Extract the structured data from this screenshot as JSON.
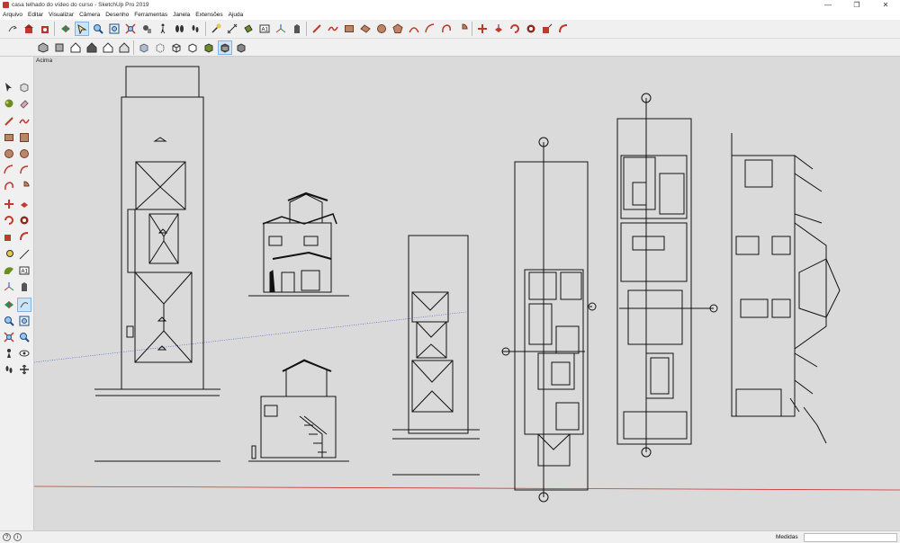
{
  "window": {
    "title": "casa telhado do vídeo do curso - SketchUp Pro 2019",
    "minimize": "—",
    "maximize": "❐",
    "close": "✕"
  },
  "menu": [
    "Arquivo",
    "Editar",
    "Visualizar",
    "Câmera",
    "Desenho",
    "Ferramentas",
    "Janela",
    "Extensões",
    "Ajuda"
  ],
  "scene": {
    "label": "Acima"
  },
  "status": {
    "measurements_label": "Medidas",
    "measurements_value": ""
  },
  "colors": {
    "accent_red": "#c0392b",
    "axis_red": "#cc3333",
    "axis_blue": "#3355cc",
    "viewport_bg": "#dadada"
  },
  "toolbar_top": [
    {
      "icon": "orbit-icon"
    },
    {
      "icon": "warehouse-icon"
    },
    {
      "icon": "extension-warehouse-icon"
    },
    {
      "icon": "section-plane-icon"
    },
    {
      "icon": "select-icon"
    },
    {
      "icon": "zoom-icon"
    },
    {
      "icon": "zoom-window-icon"
    },
    {
      "icon": "zoom-extents-icon"
    },
    {
      "icon": "position-camera-icon"
    },
    {
      "icon": "walk-icon"
    },
    {
      "icon": "look-around-icon"
    },
    {
      "icon": "tape-measure-icon"
    },
    {
      "icon": "paint-bucket-icon"
    },
    {
      "icon": "text-icon"
    },
    {
      "icon": "axes-icon"
    },
    {
      "icon": "3d-text-icon"
    },
    {
      "icon": "line-icon"
    },
    {
      "icon": "freehand-icon"
    },
    {
      "icon": "rectangle-icon"
    },
    {
      "icon": "rotated-rectangle-icon"
    },
    {
      "icon": "circle-icon"
    },
    {
      "icon": "polygon-icon"
    },
    {
      "icon": "arc-icon"
    },
    {
      "icon": "arc-2pt-icon"
    },
    {
      "icon": "arc-3pt-icon"
    },
    {
      "icon": "pie-icon"
    },
    {
      "icon": "move-icon"
    },
    {
      "icon": "push-pull-icon"
    },
    {
      "icon": "rotate-icon"
    },
    {
      "icon": "follow-me-icon"
    },
    {
      "icon": "scale-icon"
    }
  ],
  "toolbar_views": [
    {
      "icon": "iso-view-icon"
    },
    {
      "icon": "top-view-icon"
    },
    {
      "icon": "front-view-icon"
    },
    {
      "icon": "right-view-icon"
    },
    {
      "icon": "back-view-icon"
    },
    {
      "icon": "left-view-icon"
    },
    {
      "icon": "xray-icon"
    },
    {
      "icon": "back-edges-icon"
    },
    {
      "icon": "wireframe-icon"
    },
    {
      "icon": "hidden-line-icon"
    },
    {
      "icon": "shaded-icon"
    },
    {
      "icon": "shaded-textures-icon"
    },
    {
      "icon": "monochrome-icon"
    }
  ]
}
